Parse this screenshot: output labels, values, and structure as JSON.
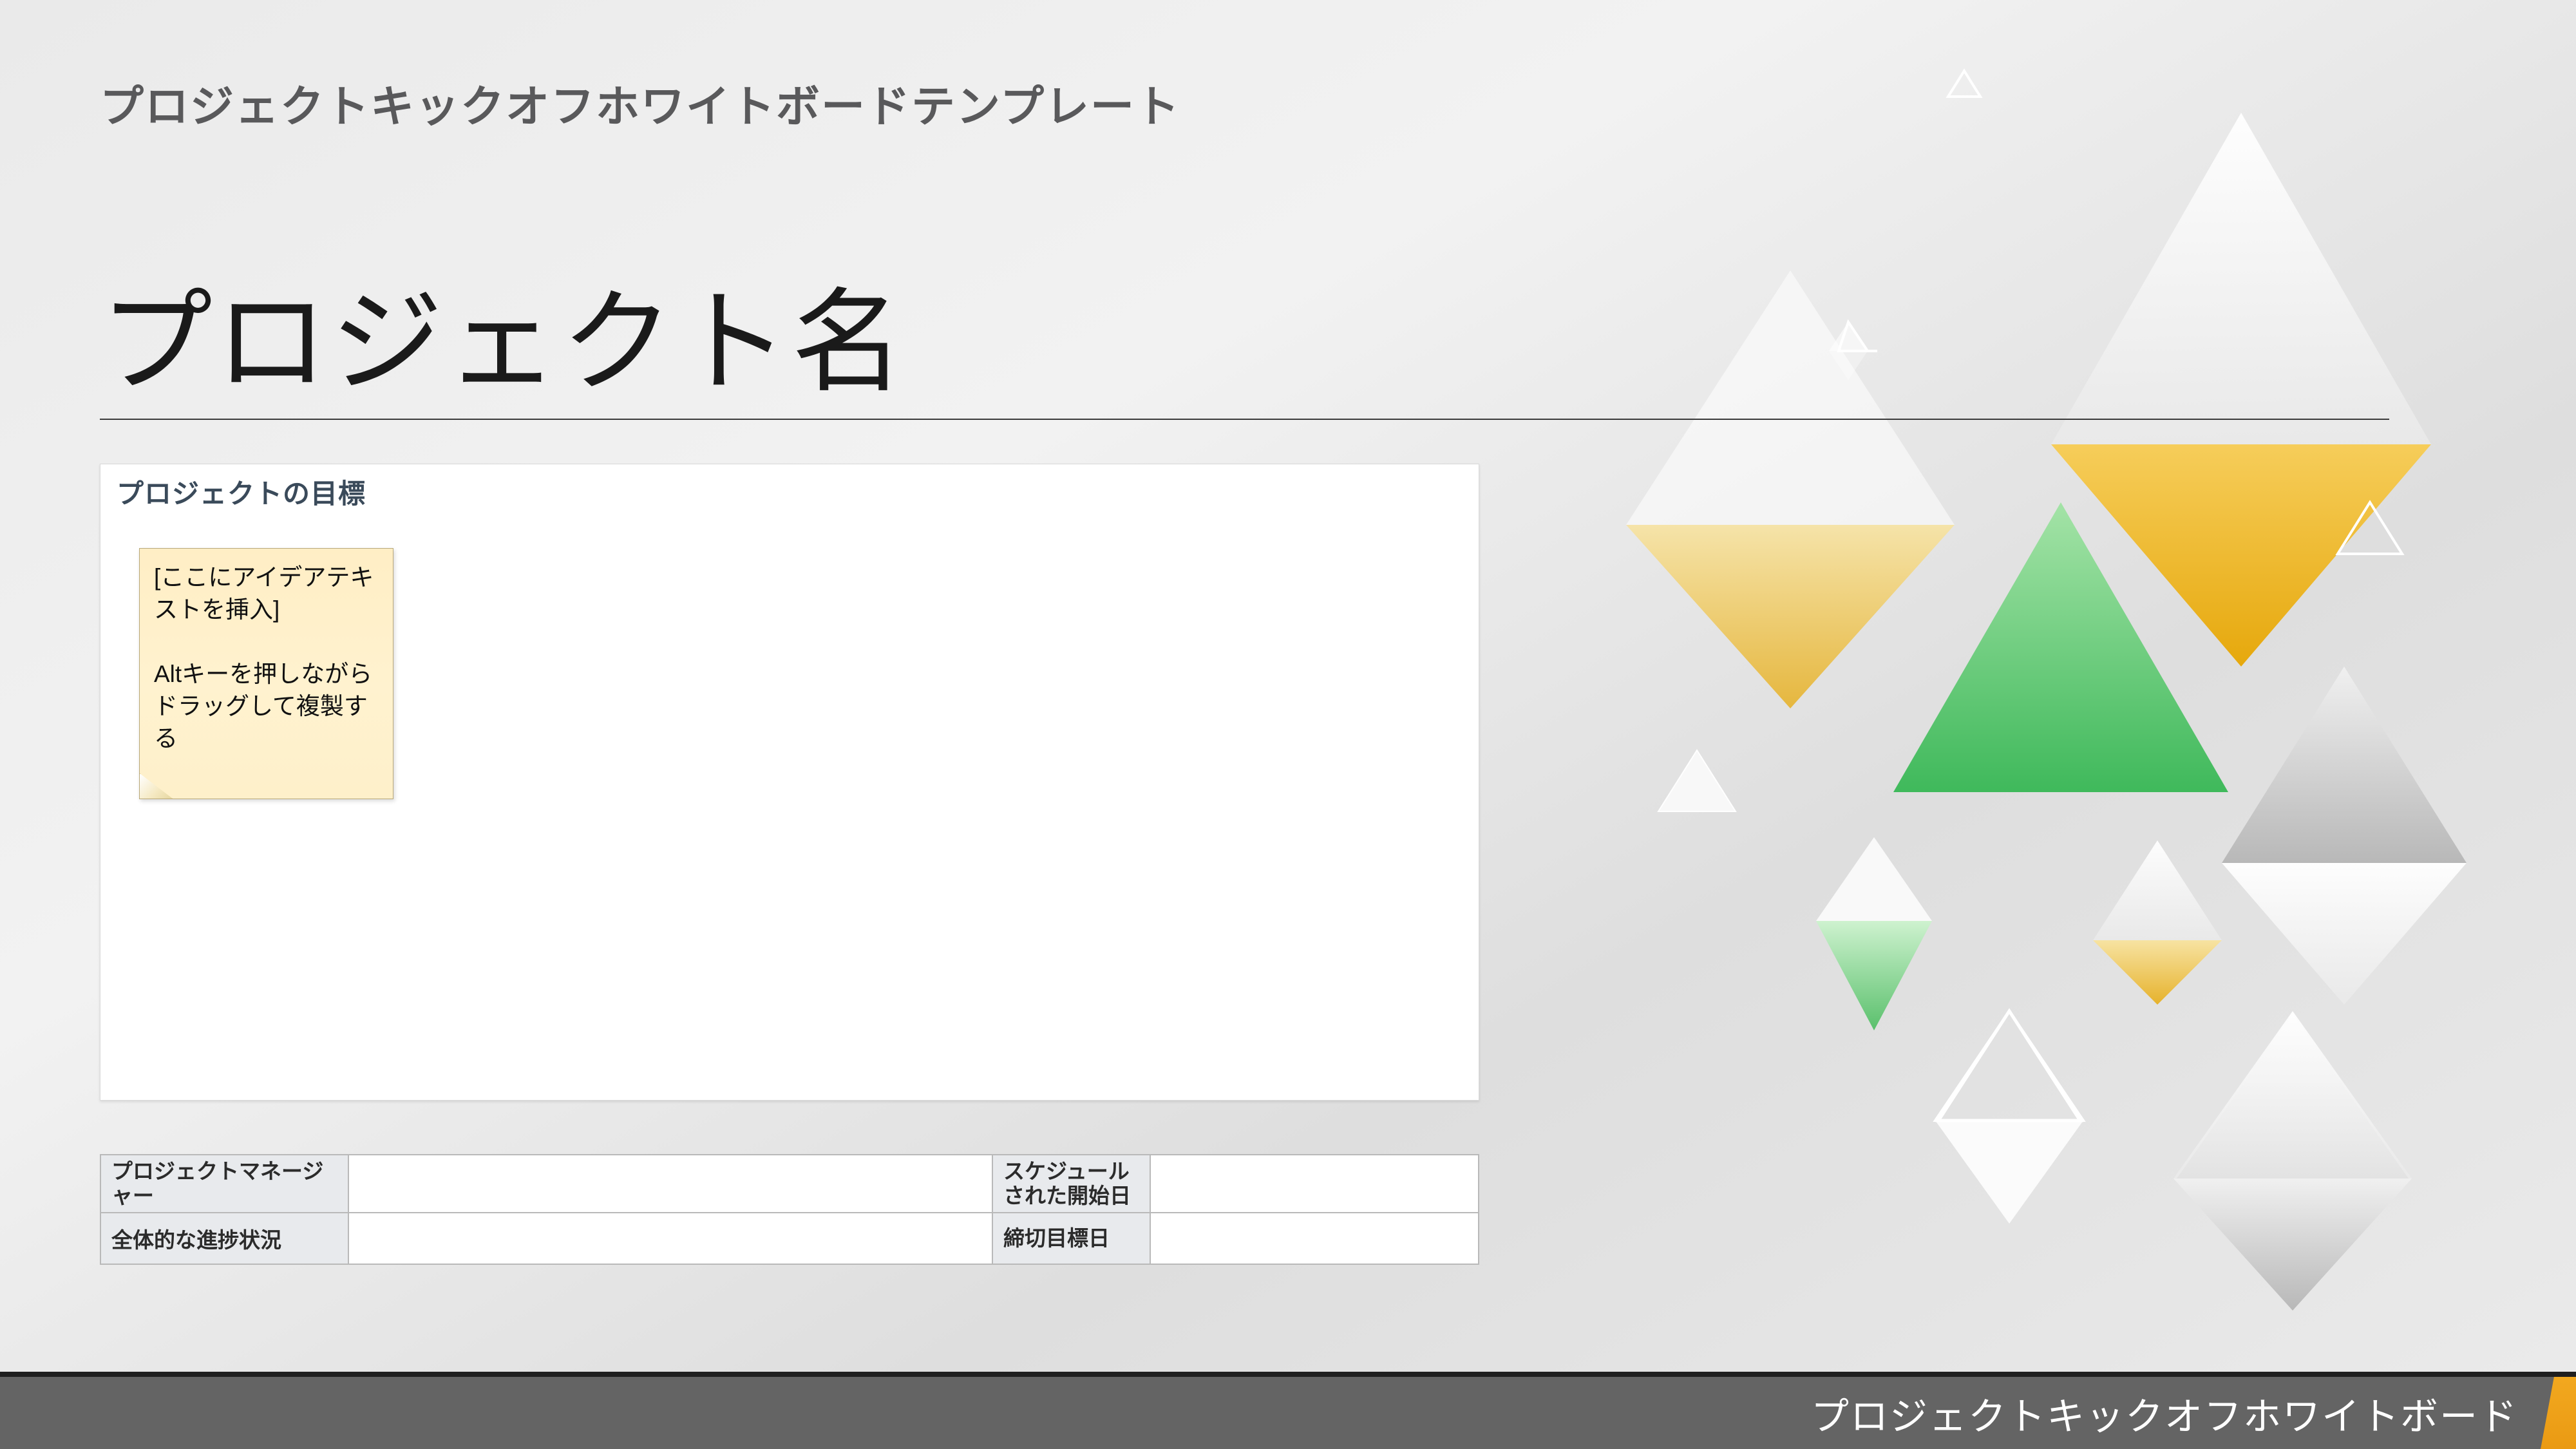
{
  "subtitle": "プロジェクトキックオフホワイトボードテンプレート",
  "title": "プロジェクト名",
  "card": {
    "header": "プロジェクトの目標",
    "sticky": "[ここにアイデアテキストを挿入]\n\nAltキーを押しながらドラッグして複製する"
  },
  "meta": {
    "pm_label": "プロジェクトマネージャー",
    "pm_value": "",
    "progress_label": "全体的な進捗状況",
    "progress_value": "",
    "start_label": "スケジュールされた開始日",
    "start_value": "",
    "deadline_label": "締切目標日",
    "deadline_value": ""
  },
  "footer": "プロジェクトキックオフホワイトボード"
}
